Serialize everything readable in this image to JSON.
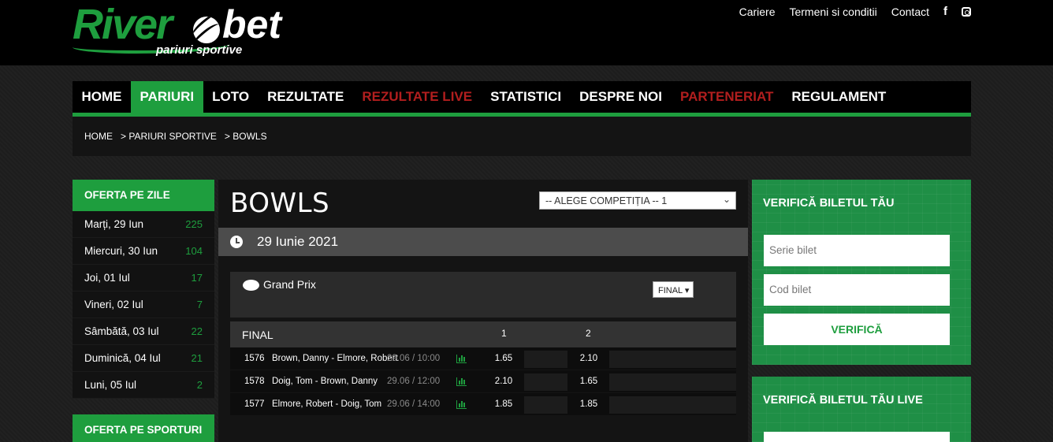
{
  "brand": {
    "name_river": "River",
    "name_bet": "bet",
    "tagline": "pariuri sportive",
    "green": "#1e9e3e",
    "red": "#b21e1e"
  },
  "toplinks": [
    "Cariere",
    "Termeni si conditii",
    "Contact"
  ],
  "social": {
    "facebook": "f"
  },
  "nav": [
    {
      "label": "HOME"
    },
    {
      "label": "PARIURI"
    },
    {
      "label": "LOTO"
    },
    {
      "label": "REZULTATE"
    },
    {
      "label": "REZULTATE LIVE"
    },
    {
      "label": "STATISTICI"
    },
    {
      "label": "DESPRE NOI"
    },
    {
      "label": "PARTENERIAT"
    },
    {
      "label": "REGULAMENT"
    }
  ],
  "breadcrumb": [
    "HOME",
    "> PARIURI SPORTIVE",
    "> BOWLS"
  ],
  "sidebar": {
    "days_title": "OFERTA PE ZILE",
    "days": [
      {
        "label": "Marți, 29 Iun",
        "count": "225"
      },
      {
        "label": "Miercuri, 30 Iun",
        "count": "104"
      },
      {
        "label": "Joi, 01 Iul",
        "count": "17"
      },
      {
        "label": "Vineri, 02 Iul",
        "count": "7"
      },
      {
        "label": "Sâmbătă, 03 Iul",
        "count": "22"
      },
      {
        "label": "Duminică, 04 Iul",
        "count": "21"
      },
      {
        "label": "Luni, 05 Iul",
        "count": "2"
      }
    ],
    "sports_title": "OFERTA PE SPORTURI"
  },
  "main": {
    "title": "BOWLS",
    "competition_select": "-- ALEGE COMPETIȚIA -- 1",
    "date": "29 Iunie 2021",
    "tournament": "Grand Prix",
    "market_select": "FINAL",
    "market_label": "FINAL",
    "col1": "1",
    "col2": "2",
    "events": [
      {
        "id": "1576",
        "name": "Brown, Danny - Elmore, Robert",
        "time": "29.06 / 10:00",
        "odd1": "1.65",
        "odd2": "2.10"
      },
      {
        "id": "1578",
        "name": "Doig, Tom - Brown, Danny",
        "time": "29.06 / 12:00",
        "odd1": "2.10",
        "odd2": "1.65"
      },
      {
        "id": "1577",
        "name": "Elmore, Robert - Doig, Tom",
        "time": "29.06 / 14:00",
        "odd1": "1.85",
        "odd2": "1.85"
      }
    ]
  },
  "right": {
    "verify_title": "VERIFICĂ BILETUL TĂU",
    "serie_placeholder": "Serie bilet",
    "cod_placeholder": "Cod bilet",
    "verify_button": "VERIFICĂ",
    "verify_live_title": "VERIFICĂ BILETUL TĂU LIVE"
  }
}
